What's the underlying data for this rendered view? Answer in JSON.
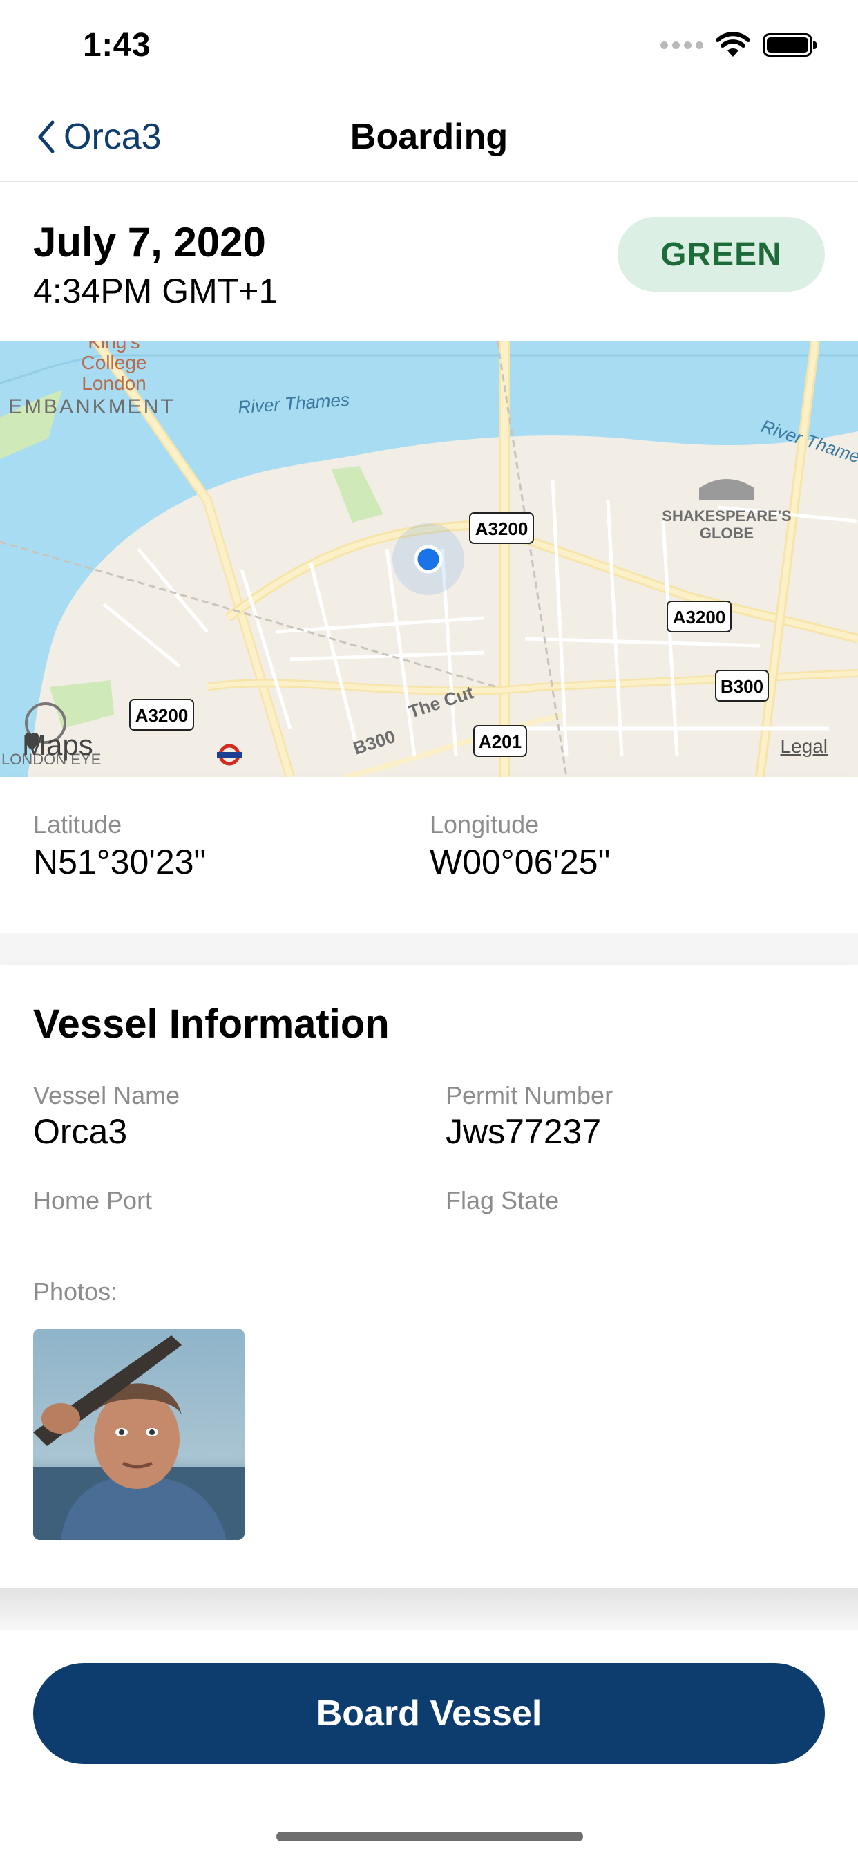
{
  "status_bar": {
    "time": "1:43"
  },
  "nav": {
    "back_label": "Orca3",
    "title": "Boarding"
  },
  "header": {
    "date": "July 7, 2020",
    "time": "4:34PM GMT+1",
    "status_badge": "GREEN"
  },
  "map": {
    "labels": {
      "kings_college": [
        "King's",
        "College",
        "London"
      ],
      "embankment": "EMBANKMENT",
      "river_thames_1": "River Thames",
      "river_thames_2": "River Thames",
      "shakespeares_globe": [
        "SHAKESPEARE'S",
        "GLOBE"
      ],
      "the_cut": "The Cut",
      "b300_road": "B300",
      "london_eye": "LONDON EYE"
    },
    "road_shields": [
      "A3200",
      "A3200",
      "A3200",
      "B300",
      "A201"
    ],
    "logo_text": "Maps",
    "legal_text": "Legal"
  },
  "coordinates": {
    "latitude_label": "Latitude",
    "latitude_value": "N51°30'23\"",
    "longitude_label": "Longitude",
    "longitude_value": "W00°06'25\""
  },
  "vessel_info": {
    "title": "Vessel Information",
    "vessel_name_label": "Vessel Name",
    "vessel_name_value": "Orca3",
    "permit_number_label": "Permit Number",
    "permit_number_value": "Jws77237",
    "home_port_label": "Home Port",
    "flag_state_label": "Flag State",
    "photos_label": "Photos:"
  },
  "action": {
    "board_button": "Board Vessel"
  },
  "colors": {
    "accent": "#0d3c6e",
    "badge_bg": "#dcefe4",
    "badge_text": "#1e6b3a",
    "water": "#a8dcf2",
    "location_dot": "#1a73e8"
  }
}
